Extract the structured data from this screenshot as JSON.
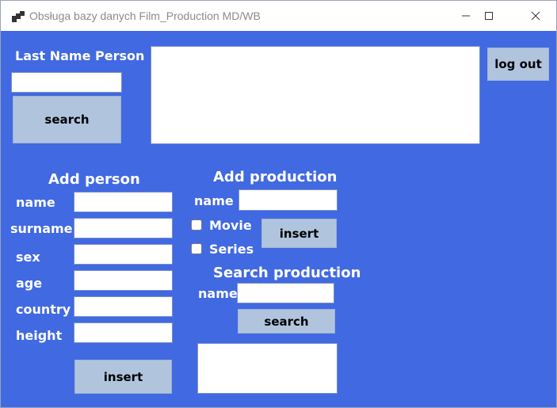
{
  "window": {
    "title": "Obsługa bazy danych Film_Production MD/WB",
    "accent_color": "#4169e1",
    "button_color": "#b0c4de"
  },
  "search_person": {
    "label": "Last Name Person",
    "input_value": "",
    "button_label": "search",
    "results": ""
  },
  "logout": {
    "label": "log out"
  },
  "add_person": {
    "title": "Add person",
    "fields": [
      {
        "label": "name",
        "value": ""
      },
      {
        "label": "surname",
        "value": ""
      },
      {
        "label": "sex",
        "value": ""
      },
      {
        "label": "age",
        "value": ""
      },
      {
        "label": "country",
        "value": ""
      },
      {
        "label": "height",
        "value": ""
      }
    ],
    "button_label": "insert"
  },
  "add_production": {
    "title": "Add production",
    "name_label": "name",
    "name_value": "",
    "movie_label": "Movie",
    "movie_checked": false,
    "series_label": "Series",
    "series_checked": false,
    "button_label": "insert"
  },
  "search_production": {
    "title": "Search production",
    "name_label": "name",
    "name_value": "",
    "button_label": "search",
    "results": ""
  }
}
